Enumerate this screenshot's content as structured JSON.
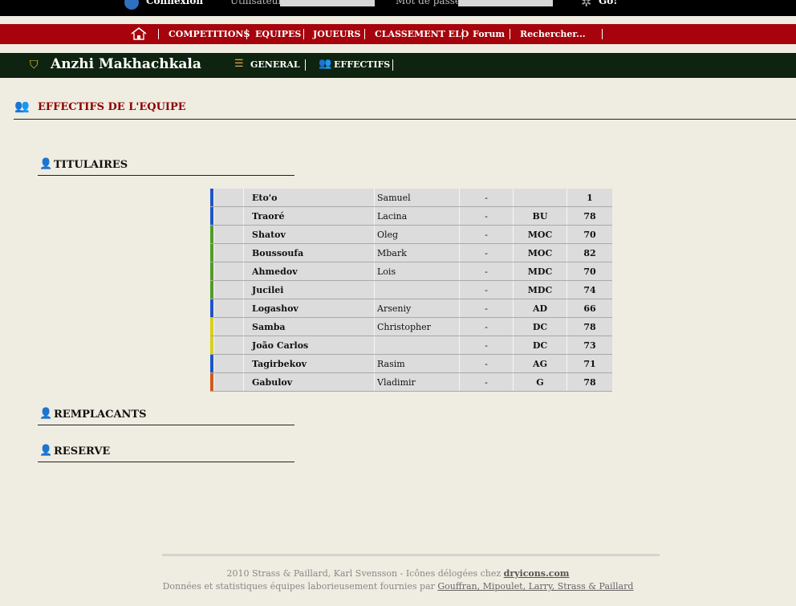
{
  "topbar": {
    "connexion": "Connexion",
    "user_label": "Utilisateur :",
    "pass_label": "Mot de passe :",
    "go": "Go!"
  },
  "nav": {
    "items": [
      "COMPETITIONS",
      "EQUIPES",
      "JOUEURS",
      "CLASSEMENT ELO",
      "Forum",
      "Rechercher..."
    ]
  },
  "team": {
    "name": "Anzhi Makhachkala",
    "tab_general": "GENERAL",
    "tab_effectifs": "EFFECTIFS"
  },
  "section": {
    "title": "EFFECTIFS DE L'EQUIPE"
  },
  "groups": {
    "titulaires": "TITULAIRES",
    "remplacants": "REMPLACANTS",
    "reserve": "RESERVE"
  },
  "players": [
    {
      "last": "Eto'o",
      "first": "Samuel",
      "dash": "-",
      "pos": "",
      "rating": "1",
      "color": "#1f55c8"
    },
    {
      "last": "Traoré",
      "first": "Lacina",
      "dash": "-",
      "pos": "BU",
      "rating": "78",
      "color": "#1f55c8"
    },
    {
      "last": "Shatov",
      "first": "Oleg",
      "dash": "-",
      "pos": "MOC",
      "rating": "70",
      "color": "#4f9a2a"
    },
    {
      "last": "Boussoufa",
      "first": "Mbark",
      "dash": "-",
      "pos": "MOC",
      "rating": "82",
      "color": "#4f9a2a"
    },
    {
      "last": "Ahmedov",
      "first": "Lois",
      "dash": "-",
      "pos": "MDC",
      "rating": "70",
      "color": "#4f9a2a"
    },
    {
      "last": "Jucilei",
      "first": "",
      "dash": "-",
      "pos": "MDC",
      "rating": "74",
      "color": "#4f9a2a"
    },
    {
      "last": "Logashov",
      "first": "Arseniy",
      "dash": "-",
      "pos": "AD",
      "rating": "66",
      "color": "#1f55c8"
    },
    {
      "last": "Samba",
      "first": "Christopher",
      "dash": "-",
      "pos": "DC",
      "rating": "78",
      "color": "#d7cf1a"
    },
    {
      "last": "João Carlos",
      "first": "",
      "dash": "-",
      "pos": "DC",
      "rating": "73",
      "color": "#d7cf1a"
    },
    {
      "last": "Tagirbekov",
      "first": "Rasim",
      "dash": "-",
      "pos": "AG",
      "rating": "71",
      "color": "#1f55c8"
    },
    {
      "last": "Gabulov",
      "first": "Vladimir",
      "dash": "-",
      "pos": "G",
      "rating": "78",
      "color": "#cf5a1c"
    }
  ],
  "footer": {
    "line1_text": "2010 Strass & Paillard, Karl Svensson - Icônes délogées chez",
    "line1_link": "dryicons.com",
    "line2_text": "Données et statistiques équipes laborieusement fournies par",
    "line2_link": "Gouffran, Mipoulet, Larry, Strass & Paillard"
  },
  "colors": {
    "red_nav": "#a6030c",
    "team_bar": "#0e2410",
    "section_title": "#8b0000",
    "background": "#efece1"
  }
}
